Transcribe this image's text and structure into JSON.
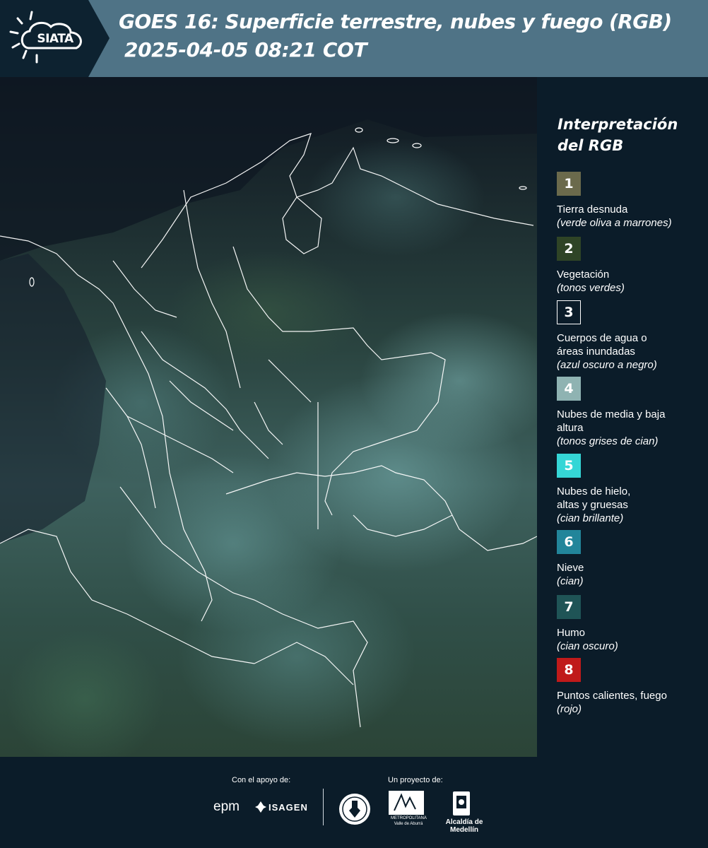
{
  "header": {
    "logo_text": "SIATA",
    "title_line1": "GOES 16: Superficie terrestre, nubes y fuego (RGB)",
    "title_line2": "2025-04-05 08:21 COT"
  },
  "map": {
    "border_color": "#ffffff"
  },
  "legend": {
    "title": "Interpretación del RGB",
    "items": [
      {
        "number": "1",
        "label": "Tierra desnuda",
        "desc": "(verde oliva a marrones)",
        "color": "#6b6a4c"
      },
      {
        "number": "2",
        "label": "Vegetación",
        "desc": "(tonos verdes)",
        "color": "#2f4426"
      },
      {
        "number": "3",
        "label": "Cuerpos de agua o áreas inundadas",
        "desc": "(azul oscuro a negro)",
        "color": "#0b1c29"
      },
      {
        "number": "4",
        "label": "Nubes de media y baja altura",
        "desc": "(tonos grises de cian)",
        "color": "#8fb3b2"
      },
      {
        "number": "5",
        "label": "Nubes de hielo, altas y gruesas",
        "desc": "(cian brillante)",
        "color": "#35d6d6"
      },
      {
        "number": "6",
        "label": "Nieve",
        "desc": "(cian)",
        "color": "#22859a"
      },
      {
        "number": "7",
        "label": "Humo",
        "desc": "(cian oscuro)",
        "color": "#1f5456"
      },
      {
        "number": "8",
        "label": "Puntos calientes, fuego",
        "desc": "(rojo)",
        "color": "#c01a1a"
      }
    ]
  },
  "footer": {
    "support_label": "Con el apoyo de:",
    "project_label": "Un proyecto de:",
    "epm": "epm",
    "isagen": "ISAGEN",
    "area_text": "METROPOLITANA Valle de Aburrá",
    "alcaldia": "Alcaldía de Medellín"
  }
}
